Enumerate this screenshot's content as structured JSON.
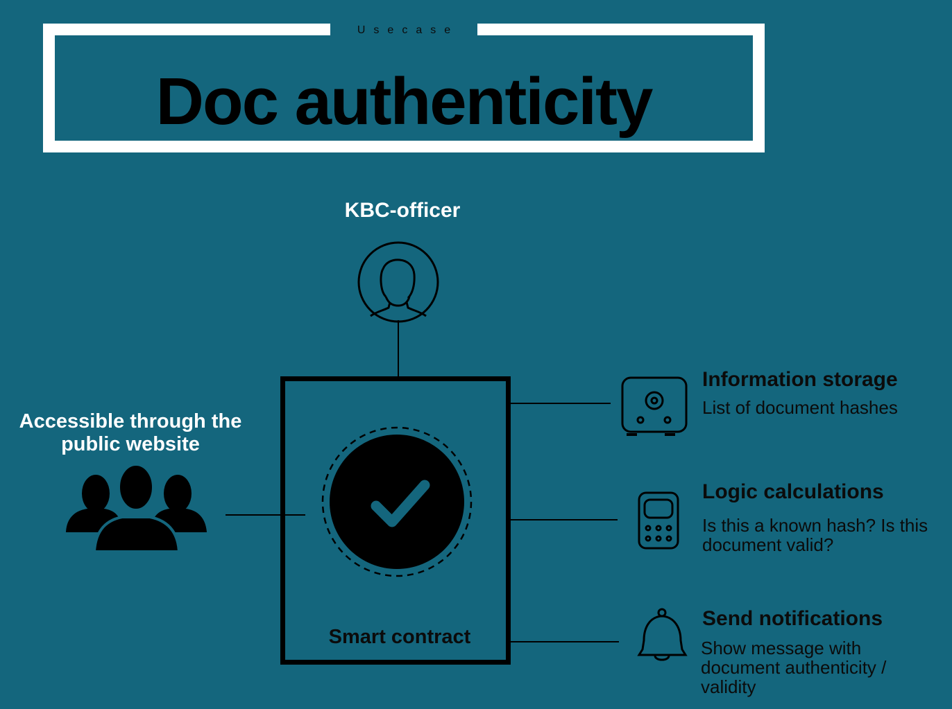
{
  "header": {
    "subtitle": "Usecase",
    "title": "Doc authenticity"
  },
  "actors": {
    "officer": {
      "label": "KBC-officer",
      "icon": "user-circle-icon"
    },
    "public": {
      "label_line1": "Accessible through the",
      "label_line2": "public website",
      "icon": "group-users-icon"
    }
  },
  "contract": {
    "label": "Smart contract",
    "icon": "checkmark-circle-icon"
  },
  "features": [
    {
      "title": "Information storage",
      "desc_lines": [
        "List of document hashes"
      ],
      "icon": "safe-icon"
    },
    {
      "title": "Logic calculations",
      "desc_lines": [
        "Is this a known hash? Is this",
        "document valid?"
      ],
      "icon": "calculator-icon"
    },
    {
      "title": "Send notifications",
      "desc_lines": [
        "Show message with",
        "document authenticity /",
        "validity"
      ],
      "icon": "bell-icon"
    }
  ],
  "colors": {
    "background": "#14667d",
    "frame": "#ffffff",
    "ink": "#000000"
  }
}
